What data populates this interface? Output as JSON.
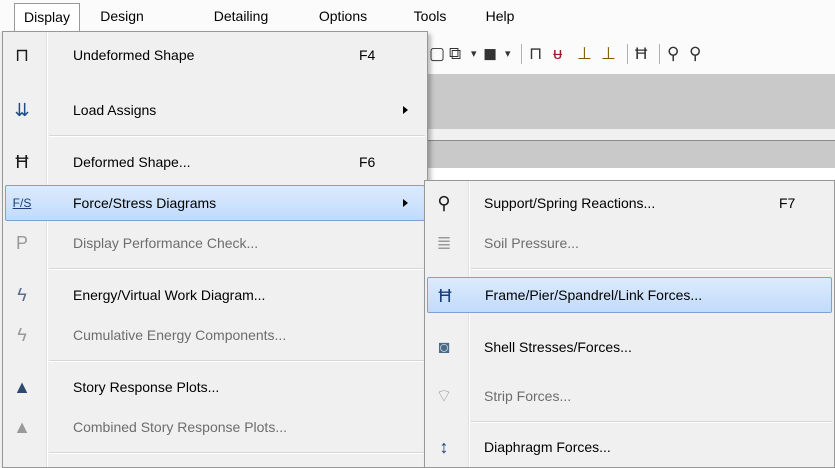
{
  "menubar": [
    "Display",
    "Design",
    "Detailing",
    "Options",
    "Tools",
    "Help"
  ],
  "display_menu": [
    {
      "label": "Undeformed Shape",
      "shortcut": "F4",
      "icon": "undeformed-shape-icon",
      "enabled": true
    },
    {
      "label": "Load Assigns",
      "submenu": true,
      "icon": "load-assigns-icon",
      "enabled": true
    },
    {
      "label": "Deformed Shape...",
      "shortcut": "F6",
      "icon": "deformed-shape-icon",
      "enabled": true
    },
    {
      "label": "Force/Stress Diagrams",
      "submenu": true,
      "icon": "force-stress-icon",
      "enabled": true,
      "highlighted": true
    },
    {
      "label": "Display Performance Check...",
      "icon": "performance-check-icon",
      "enabled": false
    },
    {
      "label": "Energy/Virtual Work Diagram...",
      "icon": "energy-icon",
      "enabled": true
    },
    {
      "label": "Cumulative Energy Components...",
      "icon": "cumulative-energy-icon",
      "enabled": false
    },
    {
      "label": "Story Response Plots...",
      "icon": "story-response-icon",
      "enabled": true
    },
    {
      "label": "Combined Story Response Plots...",
      "icon": "combined-story-icon",
      "enabled": false
    }
  ],
  "force_stress_submenu": [
    {
      "label": "Support/Spring Reactions...",
      "shortcut": "F7",
      "icon": "support-reactions-icon",
      "enabled": true
    },
    {
      "label": "Soil Pressure...",
      "icon": "soil-pressure-icon",
      "enabled": false
    },
    {
      "label": "Frame/Pier/Spandrel/Link Forces...",
      "icon": "frame-forces-icon",
      "enabled": true,
      "highlighted": true
    },
    {
      "label": "Shell Stresses/Forces...",
      "icon": "shell-stresses-icon",
      "enabled": true
    },
    {
      "label": "Strip Forces...",
      "icon": "strip-forces-icon",
      "enabled": false
    },
    {
      "label": "Diaphragm Forces...",
      "icon": "diaphragm-forces-icon",
      "enabled": true
    }
  ],
  "icon_text": {
    "force_stress": "F/S"
  }
}
